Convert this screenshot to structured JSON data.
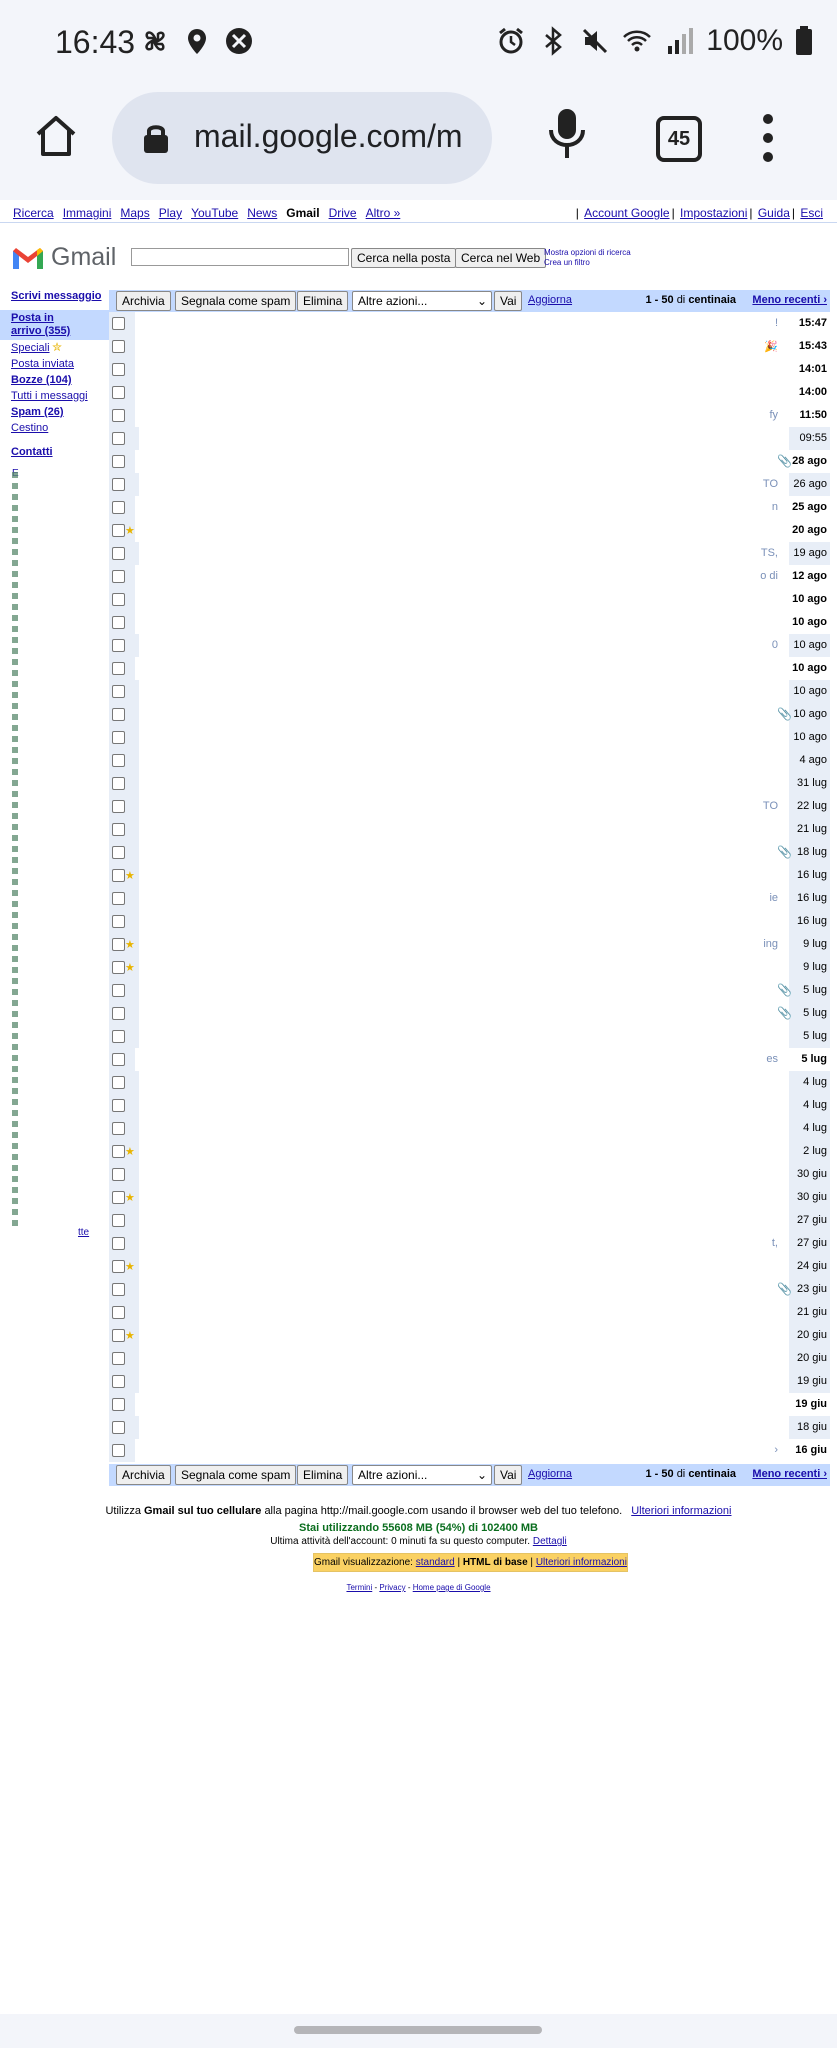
{
  "status_bar": {
    "time": "16:43",
    "battery": "100%"
  },
  "browser": {
    "url": "mail.google.com/m",
    "tab_count": "45"
  },
  "google_links": [
    "Ricerca",
    "Immagini",
    "Maps",
    "Play",
    "YouTube",
    "News",
    "Gmail",
    "Drive",
    "Altro »"
  ],
  "google_links_current": "Gmail",
  "account_links": [
    "Account Google",
    "Impostazioni",
    "Guida",
    "Esci"
  ],
  "header": {
    "logo_text": "Gmail",
    "search_mail_btn": "Cerca nella posta",
    "search_web_btn": "Cerca nel Web",
    "search_options": "Mostra opzioni di ricerca",
    "create_filter": "Crea un filtro"
  },
  "nav": {
    "compose": "Scrivi messaggio",
    "inbox": "Posta in arrivo (355)",
    "starred": "Speciali",
    "sent": "Posta inviata",
    "drafts": "Bozze (104)",
    "all": "Tutti i messaggi",
    "spam": "Spam (26)",
    "trash": "Cestino",
    "contacts": "Contatti",
    "labels_first": "E",
    "labels_more": "tte"
  },
  "toolbar": {
    "archive": "Archivia",
    "spam": "Segnala come spam",
    "delete": "Elimina",
    "more_actions": "Altre azioni...",
    "go": "Vai",
    "refresh": "Aggiorna",
    "range": "1 - 50",
    "range_of": "di",
    "range_total": "centinaia",
    "older": "Meno recenti ›"
  },
  "messages": [
    {
      "date": "15:47",
      "bold": true,
      "read": false,
      "star": false,
      "clip": false,
      "frag": "!"
    },
    {
      "date": "15:43",
      "bold": true,
      "read": false,
      "star": false,
      "clip": false,
      "frag": "🎉",
      "red": true
    },
    {
      "date": "14:01",
      "bold": true,
      "read": false,
      "star": false,
      "clip": false,
      "frag": ""
    },
    {
      "date": "14:00",
      "bold": true,
      "read": false,
      "star": false,
      "clip": false,
      "frag": ""
    },
    {
      "date": "11:50",
      "bold": true,
      "read": false,
      "star": false,
      "clip": false,
      "frag": "fy"
    },
    {
      "date": "09:55",
      "bold": false,
      "read": true,
      "star": false,
      "clip": false,
      "frag": ""
    },
    {
      "date": "28 ago",
      "bold": true,
      "read": false,
      "star": false,
      "clip": true,
      "frag": ""
    },
    {
      "date": "26 ago",
      "bold": false,
      "read": true,
      "star": false,
      "clip": false,
      "frag": "TO"
    },
    {
      "date": "25 ago",
      "bold": true,
      "read": false,
      "star": false,
      "clip": false,
      "frag": "n"
    },
    {
      "date": "20 ago",
      "bold": true,
      "read": false,
      "star": true,
      "clip": false,
      "frag": ""
    },
    {
      "date": "19 ago",
      "bold": false,
      "read": true,
      "star": false,
      "clip": false,
      "frag": "TS,"
    },
    {
      "date": "12 ago",
      "bold": true,
      "read": false,
      "star": false,
      "clip": false,
      "frag": "o di"
    },
    {
      "date": "10 ago",
      "bold": true,
      "read": false,
      "star": false,
      "clip": false,
      "frag": ""
    },
    {
      "date": "10 ago",
      "bold": true,
      "read": false,
      "star": false,
      "clip": false,
      "frag": ""
    },
    {
      "date": "10 ago",
      "bold": false,
      "read": true,
      "star": false,
      "clip": false,
      "frag": "0"
    },
    {
      "date": "10 ago",
      "bold": true,
      "read": false,
      "star": false,
      "clip": false,
      "frag": ""
    },
    {
      "date": "10 ago",
      "bold": false,
      "read": true,
      "star": false,
      "clip": false,
      "frag": ""
    },
    {
      "date": "10 ago",
      "bold": false,
      "read": true,
      "star": false,
      "clip": true,
      "frag": ""
    },
    {
      "date": "10 ago",
      "bold": false,
      "read": true,
      "star": false,
      "clip": false,
      "frag": ""
    },
    {
      "date": "4 ago",
      "bold": false,
      "read": true,
      "star": false,
      "clip": false,
      "frag": ""
    },
    {
      "date": "31 lug",
      "bold": false,
      "read": true,
      "star": false,
      "clip": false,
      "frag": ""
    },
    {
      "date": "22 lug",
      "bold": false,
      "read": true,
      "star": false,
      "clip": false,
      "frag": "TO"
    },
    {
      "date": "21 lug",
      "bold": false,
      "read": true,
      "star": false,
      "clip": false,
      "frag": ""
    },
    {
      "date": "18 lug",
      "bold": false,
      "read": true,
      "star": false,
      "clip": true,
      "frag": ""
    },
    {
      "date": "16 lug",
      "bold": false,
      "read": true,
      "star": true,
      "clip": false,
      "frag": ""
    },
    {
      "date": "16 lug",
      "bold": false,
      "read": true,
      "star": false,
      "clip": false,
      "frag": "ie"
    },
    {
      "date": "16 lug",
      "bold": false,
      "read": true,
      "star": false,
      "clip": false,
      "frag": ""
    },
    {
      "date": "9 lug",
      "bold": false,
      "read": true,
      "star": true,
      "clip": false,
      "frag": "ing"
    },
    {
      "date": "9 lug",
      "bold": false,
      "read": true,
      "star": true,
      "clip": false,
      "frag": ""
    },
    {
      "date": "5 lug",
      "bold": false,
      "read": true,
      "star": false,
      "clip": true,
      "frag": ""
    },
    {
      "date": "5 lug",
      "bold": false,
      "read": true,
      "star": false,
      "clip": true,
      "frag": ""
    },
    {
      "date": "5 lug",
      "bold": false,
      "read": true,
      "star": false,
      "clip": false,
      "frag": ""
    },
    {
      "date": "5 lug",
      "bold": true,
      "read": false,
      "star": false,
      "clip": false,
      "frag": "es"
    },
    {
      "date": "4 lug",
      "bold": false,
      "read": true,
      "star": false,
      "clip": false,
      "frag": ""
    },
    {
      "date": "4 lug",
      "bold": false,
      "read": true,
      "star": false,
      "clip": false,
      "frag": ""
    },
    {
      "date": "4 lug",
      "bold": false,
      "read": true,
      "star": false,
      "clip": false,
      "frag": ""
    },
    {
      "date": "2 lug",
      "bold": false,
      "read": true,
      "star": true,
      "clip": false,
      "frag": ""
    },
    {
      "date": "30 giu",
      "bold": false,
      "read": true,
      "star": false,
      "clip": false,
      "frag": ""
    },
    {
      "date": "30 giu",
      "bold": false,
      "read": true,
      "star": true,
      "clip": false,
      "frag": ""
    },
    {
      "date": "27 giu",
      "bold": false,
      "read": true,
      "star": false,
      "clip": false,
      "frag": ""
    },
    {
      "date": "27 giu",
      "bold": false,
      "read": true,
      "star": false,
      "clip": false,
      "frag": "t,"
    },
    {
      "date": "24 giu",
      "bold": false,
      "read": true,
      "star": true,
      "clip": false,
      "frag": ""
    },
    {
      "date": "23 giu",
      "bold": false,
      "read": true,
      "star": false,
      "clip": true,
      "frag": ""
    },
    {
      "date": "21 giu",
      "bold": false,
      "read": true,
      "star": false,
      "clip": false,
      "frag": ""
    },
    {
      "date": "20 giu",
      "bold": false,
      "read": true,
      "star": true,
      "clip": false,
      "frag": ""
    },
    {
      "date": "20 giu",
      "bold": false,
      "read": true,
      "star": false,
      "clip": false,
      "frag": ""
    },
    {
      "date": "19 giu",
      "bold": false,
      "read": true,
      "star": false,
      "clip": false,
      "frag": ""
    },
    {
      "date": "19 giu",
      "bold": true,
      "read": false,
      "star": false,
      "clip": false,
      "frag": ""
    },
    {
      "date": "18 giu",
      "bold": false,
      "read": true,
      "star": false,
      "clip": false,
      "frag": ""
    },
    {
      "date": "16 giu",
      "bold": true,
      "read": false,
      "star": false,
      "clip": false,
      "frag": "›"
    }
  ],
  "footer": {
    "mobile_pre": "Utilizza",
    "mobile_bold": "Gmail sul tuo cellulare",
    "mobile_post": "alla pagina http://mail.google.com usando il browser web del tuo telefono.",
    "more_info": "Ulteriori informazioni",
    "usage": "Stai utilizzando 55608 MB (54%) di 102400 MB",
    "activity": "Ultima attività dell'account: 0 minuti fa su questo computer.",
    "details": "Dettagli",
    "view_label": "Gmail visualizzazione:",
    "view_standard": "standard",
    "view_html": "HTML di base",
    "view_more": "Ulteriori informazioni",
    "terms": "Termini",
    "privacy": "Privacy",
    "home": "Home page di Google"
  },
  "colors": {
    "accent": "#c3d9ff",
    "link": "#1a0dab",
    "read_row": "#e8eef7",
    "usage_green": "#0b6e1f"
  }
}
